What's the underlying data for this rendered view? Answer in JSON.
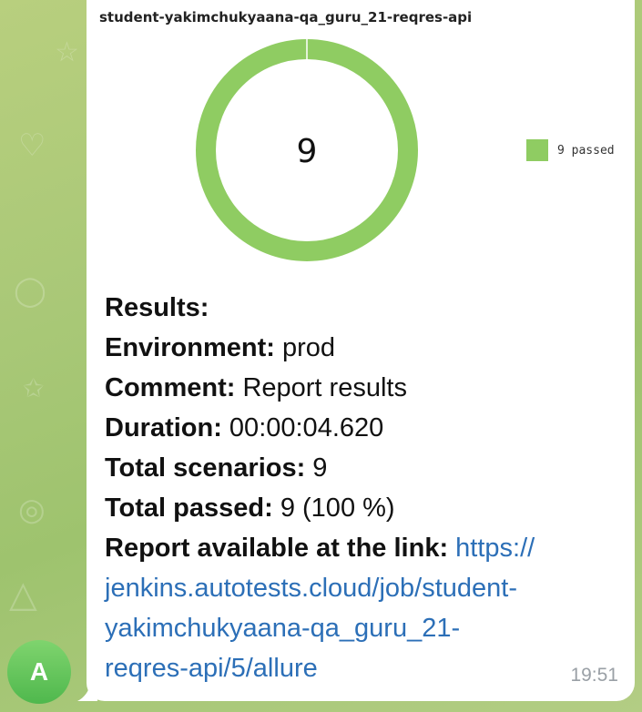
{
  "message": {
    "chart_title": "student-yakimchukyaana-qa_guru_21-reqres-api",
    "results_heading": "Results:",
    "rows": [
      {
        "label": "Environment:",
        "value": " prod"
      },
      {
        "label": "Comment:",
        "value": " Report results"
      },
      {
        "label": "Duration:",
        "value": " 00:00:04.620"
      },
      {
        "label": "Total scenarios:",
        "value": " 9"
      },
      {
        "label": "Total passed:",
        "value": " 9 (100 %)"
      }
    ],
    "report_label": "Report available at the link:",
    "report_link_line1": "https://",
    "report_link_line2": "jenkins.autotests.cloud/job/student-",
    "report_link_line3": "yakimchukyaana-qa_guru_21-",
    "report_link_line4": "reqres-api/5/allure",
    "time": "19:51"
  },
  "sender": {
    "avatar_letter": "A"
  },
  "colors": {
    "passed": "#8fcc62",
    "link": "#2c6fb7",
    "avatar": "#4fb84d"
  },
  "chart_data": {
    "type": "pie",
    "title": "student-yakimchukyaana-qa_guru_21-reqres-api",
    "center_label": "9",
    "series": [
      {
        "name": "9 passed",
        "value": 9,
        "color": "#8fcc62"
      }
    ],
    "legend": "right"
  }
}
